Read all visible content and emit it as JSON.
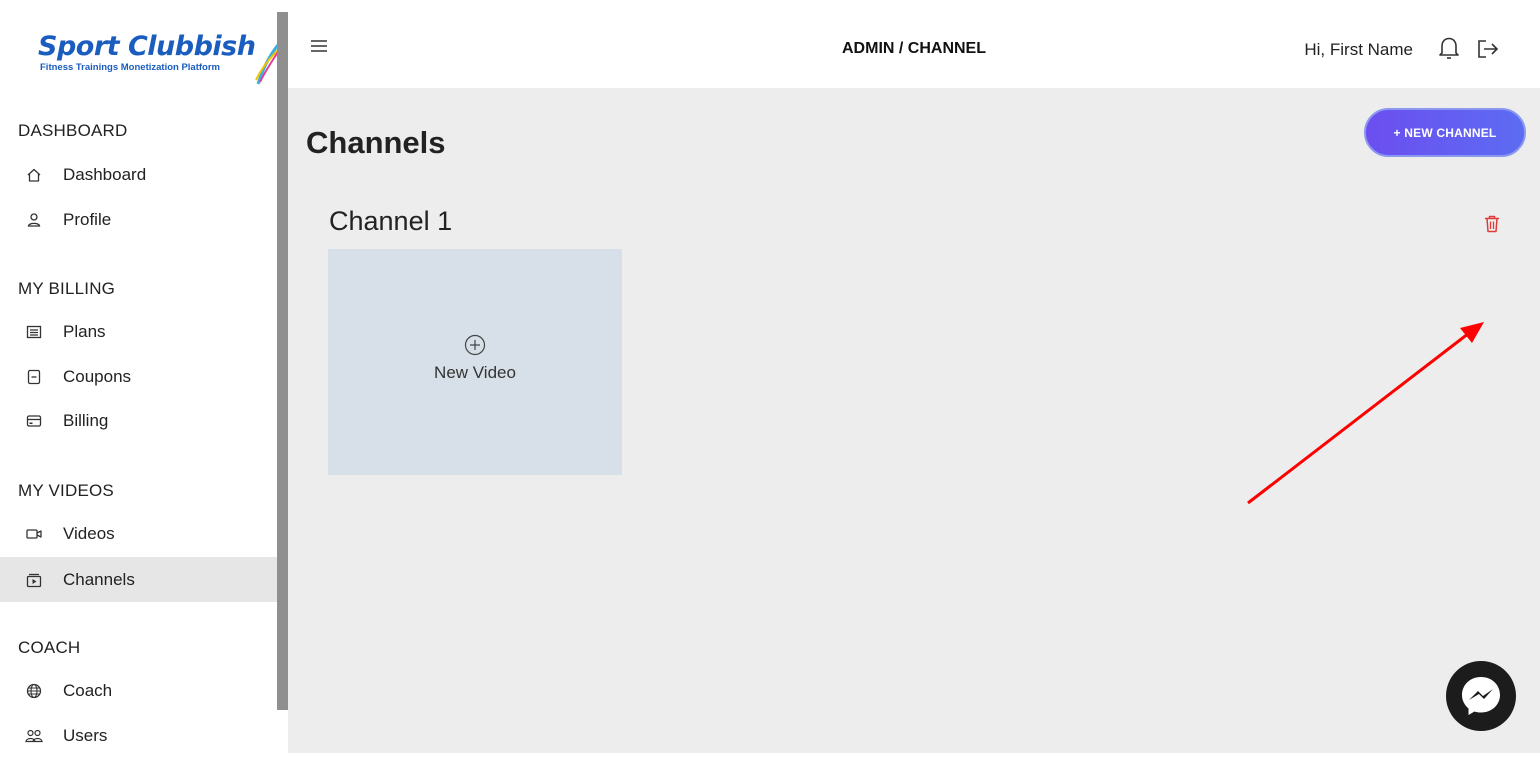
{
  "logo": {
    "title": "Sport Clubbish",
    "subtitle": "Fitness Trainings Monetization Platform"
  },
  "sidebar": {
    "sections": [
      {
        "title": "DASHBOARD",
        "items": [
          {
            "label": "Dashboard",
            "icon": "home-icon"
          },
          {
            "label": "Profile",
            "icon": "user-icon"
          }
        ]
      },
      {
        "title": "MY BILLING",
        "items": [
          {
            "label": "Plans",
            "icon": "list-icon"
          },
          {
            "label": "Coupons",
            "icon": "coupon-icon"
          },
          {
            "label": "Billing",
            "icon": "credit-card-icon"
          }
        ]
      },
      {
        "title": "MY VIDEOS",
        "items": [
          {
            "label": "Videos",
            "icon": "video-camera-icon"
          },
          {
            "label": "Channels",
            "icon": "channel-icon",
            "active": true
          }
        ]
      },
      {
        "title": "COACH",
        "items": [
          {
            "label": "Coach",
            "icon": "globe-icon"
          },
          {
            "label": "Users",
            "icon": "users-icon"
          }
        ]
      }
    ]
  },
  "topbar": {
    "breadcrumb": "ADMIN / CHANNEL",
    "greeting": "Hi, First Name"
  },
  "main": {
    "title": "Channels",
    "new_channel_label": "+ NEW CHANNEL",
    "channel": {
      "name": "Channel 1",
      "new_video_label": "New Video"
    }
  },
  "colors": {
    "brand": "#1a5dbf",
    "accent": "#6c4ef0",
    "danger": "#e03a3a",
    "arrow": "#ff0000"
  }
}
